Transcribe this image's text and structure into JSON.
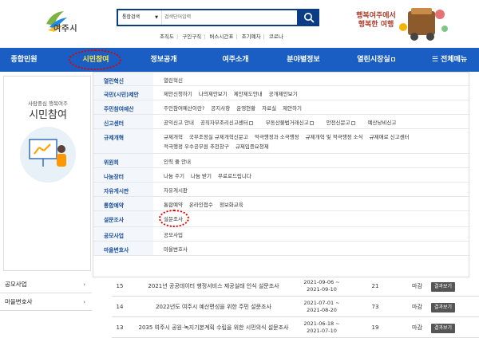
{
  "header": {
    "logo_text": "여주시",
    "search": {
      "select_label": "통합검색",
      "placeholder": "검색단어입력"
    },
    "quick_links": [
      "조직도",
      "구인구직",
      "버스시간표",
      "조기폐차",
      "코로나"
    ],
    "banner_text_1": "행복여주에서",
    "banner_text_2": "행복한 여행"
  },
  "nav": {
    "items": [
      "종합민원",
      "시민참여",
      "정보공개",
      "여주소개",
      "분야별정보",
      "열린시장실",
      "전체메뉴"
    ]
  },
  "left": {
    "subtitle": "사람중심 행복여주",
    "title": "시민참여",
    "side_items": [
      "공모사업",
      "마을변호사"
    ]
  },
  "mega": {
    "rows": [
      {
        "cat": "열린혁신",
        "links": [
          "열린혁신"
        ]
      },
      {
        "cat": "국민(시민)제안",
        "links": [
          "제안신청하기",
          "나의제안보기",
          "제안제도안내",
          "공개제안보기"
        ]
      },
      {
        "cat": "주민참여예산",
        "links": [
          "주민참여예산이란?",
          "공지사항",
          "운영현황",
          "자료실",
          "제안하기"
        ]
      },
      {
        "cat": "신고센터",
        "links": [
          "공익신고 안내",
          "공직자부조리신고센터",
          "부동산불법거래신고",
          "안전신문고",
          "예산낭비신고"
        ]
      },
      {
        "cat": "규제개혁",
        "links": [
          "규제개혁",
          "국무조정실 규제개혁신문고",
          "적극행정과 소극행정",
          "규제개혁 및 적극행정 소식",
          "규제애로 신고센터",
          "적극행정 우수공무원 추천창구",
          "규제입증요청제"
        ]
      },
      {
        "cat": "위원회",
        "links": [
          "인력 풀 안내"
        ]
      },
      {
        "cat": "나눔장터",
        "links": [
          "나눔 주기",
          "나눔 받기",
          "무료로드립니다"
        ]
      },
      {
        "cat": "자유게시판",
        "links": [
          "자유게시판"
        ]
      },
      {
        "cat": "통합예약",
        "links": [
          "통합예약",
          "온라인접수",
          "정보화교육"
        ]
      },
      {
        "cat": "설문조사",
        "links": [
          "설문조사"
        ]
      },
      {
        "cat": "공모사업",
        "links": [
          "공모사업"
        ]
      },
      {
        "cat": "마을변호사",
        "links": [
          "마을변호사"
        ]
      }
    ]
  },
  "table": {
    "rows": [
      {
        "num": "15",
        "title": "2021년 공공데이터 행정서비스 제공실태 인식 설문조사",
        "date1": "2021-09-06 ~",
        "date2": "2021-09-10",
        "count": "21",
        "status": "마감",
        "btn": "결과보기"
      },
      {
        "num": "14",
        "title": "2022년도 여주시 예산편성을 위한 주민 설문조사",
        "date1": "2021-07-01 ~",
        "date2": "2021-08-20",
        "count": "73",
        "status": "마감",
        "btn": "결과보기"
      },
      {
        "num": "13",
        "title": "2035 여주시 공원·녹지기본계획 수립을 위한 시민의식 설문조사",
        "date1": "2021-06-18 ~",
        "date2": "2021-07-10",
        "count": "19",
        "status": "마감",
        "btn": "결과보기"
      }
    ]
  },
  "colors": {
    "nav_bg": "#1a5ec4",
    "nav_active": "#ffe94a",
    "highlight": "#e10000",
    "search_border": "#0d3c87"
  }
}
